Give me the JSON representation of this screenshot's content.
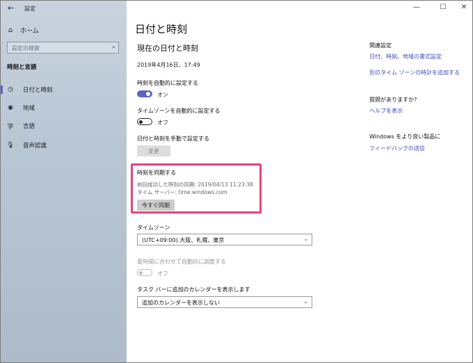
{
  "window": {
    "app_title": "設定",
    "back_icon": "back-arrow-icon",
    "minimize_glyph": "—",
    "maximize_glyph": "☐",
    "close_glyph": "✕"
  },
  "sidebar": {
    "home_label": "ホーム",
    "search_placeholder": "設定の検索",
    "section_title": "時刻と言語",
    "items": [
      {
        "label": "日付と時刻",
        "icon": "date-time-icon",
        "selected": true
      },
      {
        "label": "地域",
        "icon": "globe-icon",
        "selected": false
      },
      {
        "label": "言語",
        "icon": "language-icon",
        "selected": false
      },
      {
        "label": "音声認識",
        "icon": "microphone-icon",
        "selected": false
      }
    ]
  },
  "main": {
    "page_title": "日付と時刻",
    "section_title": "現在の日付と時刻",
    "current_datetime": "2019年4月16日、17:49",
    "auto_time": {
      "label": "時刻を自動的に設定する",
      "state": "オン"
    },
    "auto_timezone": {
      "label": "タイムゾーンを自動的に設定する",
      "state": "オフ"
    },
    "manual": {
      "label": "日付と時刻を手動で設定する",
      "button": "変更"
    },
    "sync": {
      "title": "時刻を同期する",
      "last_sync": "前回成功した時刻の同期: 2019/04/13 11:23:38",
      "server": "タイム サーバー: time.windows.com",
      "button": "今すぐ同期"
    },
    "timezone": {
      "label": "タイムゾーン",
      "value": "(UTC+09:00) 大阪、札幌、東京"
    },
    "dst": {
      "label": "夏時間に合わせて自動的に調整する",
      "state": "オフ"
    },
    "calendar": {
      "label": "タスク バーに追加のカレンダーを表示します",
      "value": "追加のカレンダーを表示しない"
    }
  },
  "right_panel": {
    "related_title": "関連設定",
    "related_links": [
      "日付、時刻、地域の書式設定",
      "別のタイム ゾーンの時計を追加する"
    ],
    "question_title": "質問がありますか?",
    "help_link": "ヘルプを表示",
    "improve_title": "Windows をより良い製品に",
    "feedback_link": "フィードバックの送信"
  },
  "colors": {
    "accent": "#5b63c9",
    "link": "#3b4bc0",
    "highlight_box": "#e8417f"
  }
}
